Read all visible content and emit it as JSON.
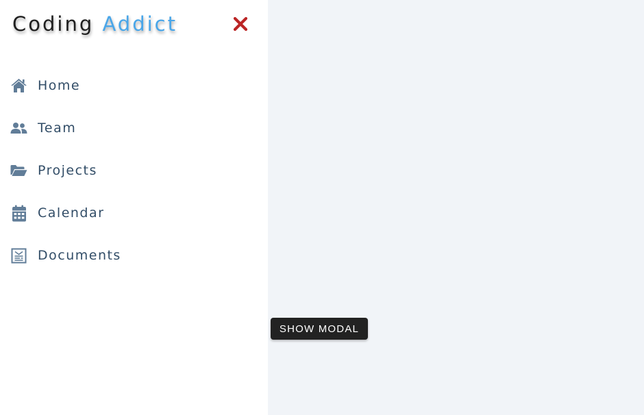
{
  "sidebar": {
    "logo": {
      "part1": "Coding",
      "part2": "Addict"
    },
    "items": [
      {
        "label": "Home",
        "icon": "home-icon"
      },
      {
        "label": "Team",
        "icon": "users-icon"
      },
      {
        "label": "Projects",
        "icon": "folder-open-icon"
      },
      {
        "label": "Calendar",
        "icon": "calendar-icon"
      },
      {
        "label": "Documents",
        "icon": "document-icon"
      }
    ]
  },
  "main": {
    "button_label": "SHOW MODAL"
  },
  "colors": {
    "accent": "#49a6e9",
    "close": "#bb2525",
    "icon": "#617d98",
    "text": "#324d67",
    "background": "#f1f4f8",
    "button": "#222222"
  }
}
